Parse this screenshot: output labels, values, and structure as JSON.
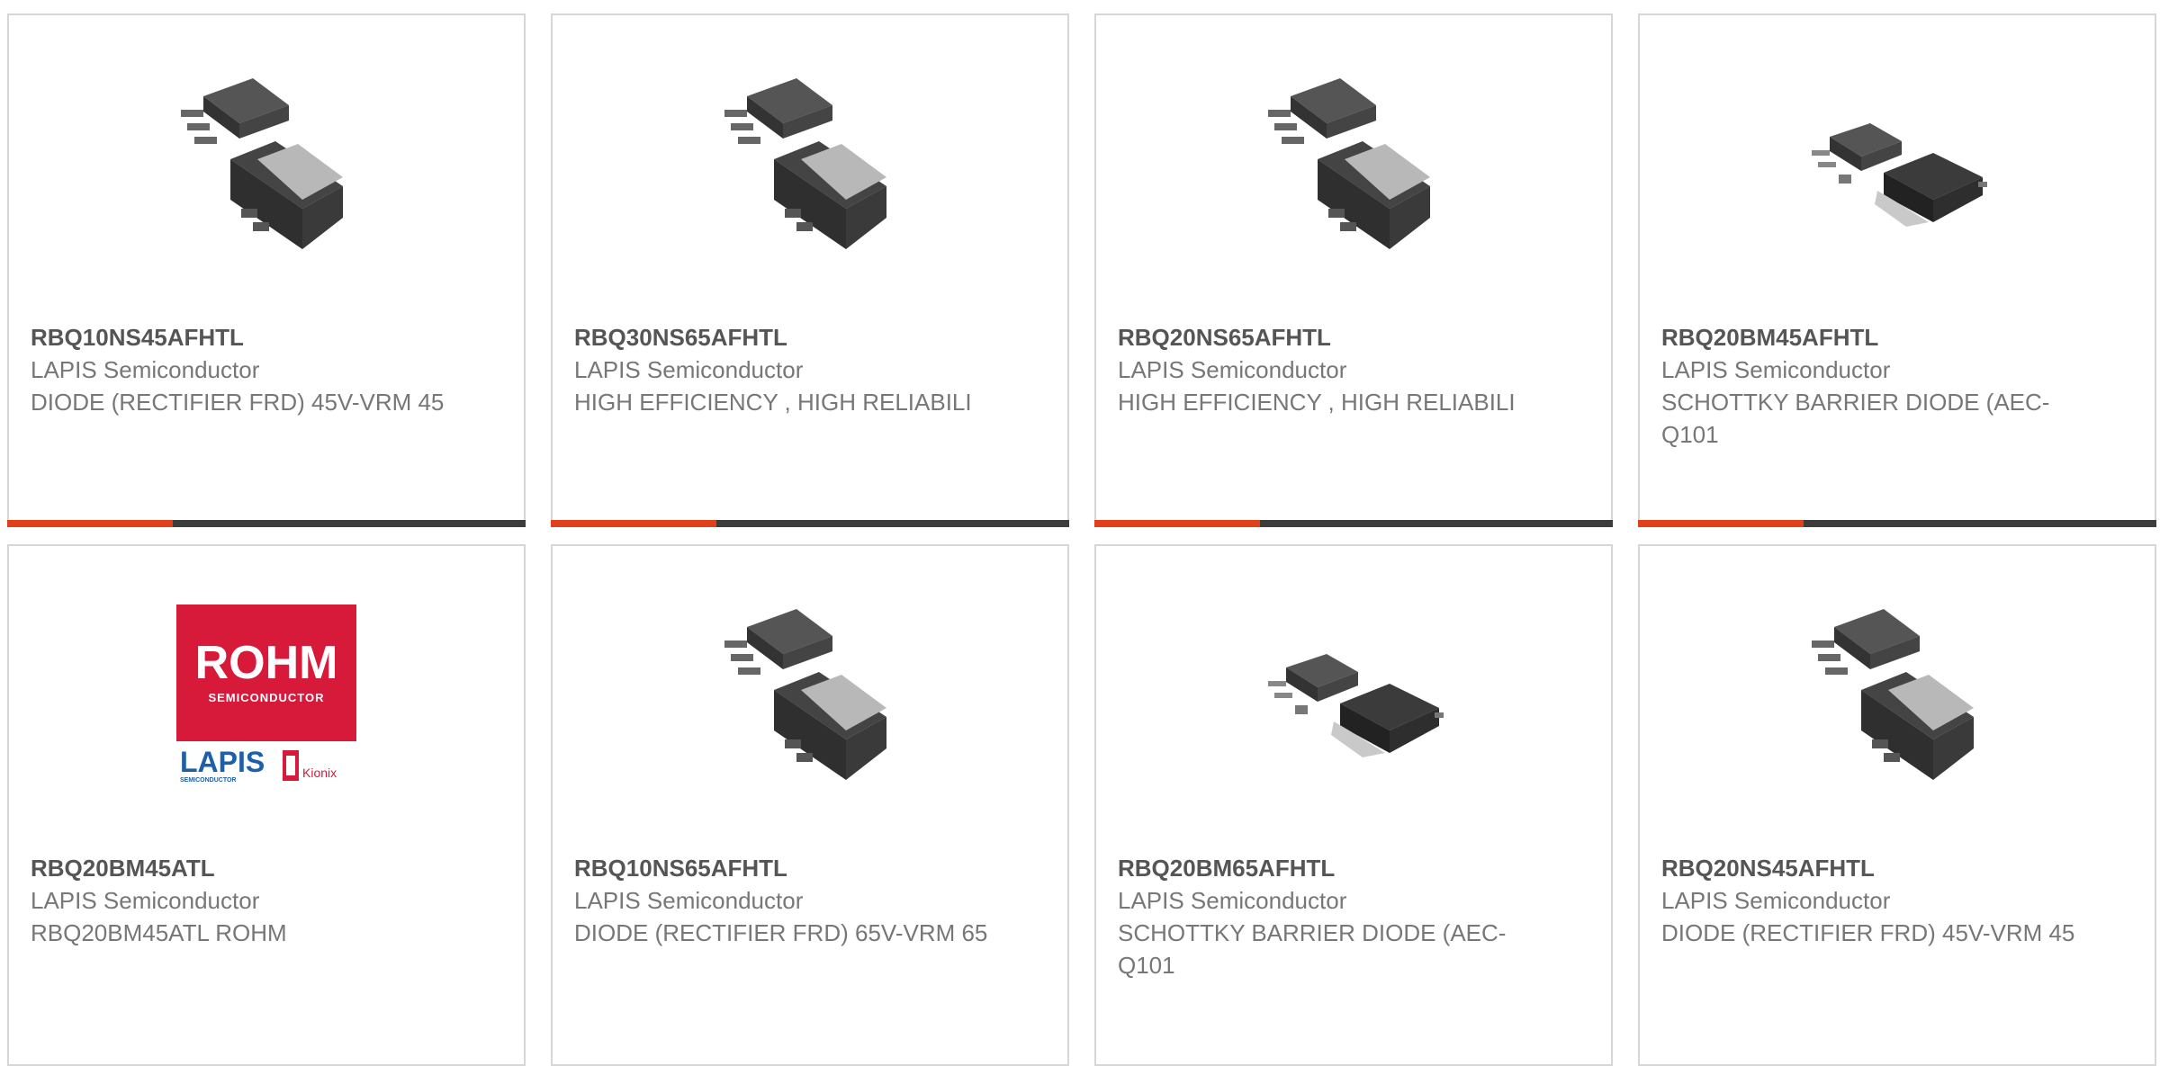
{
  "products": [
    {
      "part": "RBQ10NS45AFHTL",
      "maker": "LAPIS Semiconductor",
      "desc": "DIODE (RECTIFIER FRD) 45V-VRM 45",
      "image": "dpak-package-icon"
    },
    {
      "part": "RBQ30NS65AFHTL",
      "maker": "LAPIS Semiconductor",
      "desc": "HIGH EFFICIENCY , HIGH RELIABILI",
      "image": "dpak-package-icon"
    },
    {
      "part": "RBQ20NS65AFHTL",
      "maker": "LAPIS Semiconductor",
      "desc": "HIGH EFFICIENCY , HIGH RELIABILI",
      "image": "dpak-package-icon"
    },
    {
      "part": "RBQ20BM45AFHTL",
      "maker": "LAPIS Semiconductor",
      "desc": "SCHOTTKY BARRIER DIODE (AEC-Q101",
      "image": "to252-package-icon"
    },
    {
      "part": "RBQ20BM45ATL",
      "maker": "LAPIS Semiconductor",
      "desc": "RBQ20BM45ATL ROHM",
      "image": "rohm-logo",
      "logo": {
        "brand": "ROHM",
        "sub": "SEMICONDUCTOR",
        "lapis": "LAPIS",
        "lapis_sub": "SEMICONDUCTOR",
        "kionix": "Kionix"
      }
    },
    {
      "part": "RBQ10NS65AFHTL",
      "maker": "LAPIS Semiconductor",
      "desc": "DIODE (RECTIFIER FRD) 65V-VRM 65",
      "image": "dpak-package-icon"
    },
    {
      "part": "RBQ20BM65AFHTL",
      "maker": "LAPIS Semiconductor",
      "desc": "SCHOTTKY BARRIER DIODE (AEC-Q101",
      "image": "to252-package-icon"
    },
    {
      "part": "RBQ20NS45AFHTL",
      "maker": "LAPIS Semiconductor",
      "desc": "DIODE (RECTIFIER FRD) 45V-VRM 45",
      "image": "dpak-package-icon"
    }
  ],
  "colors": {
    "accent": "#e0401a",
    "bar": "#3c3c3c",
    "border": "#d6d6d6",
    "logo_red": "#d7193a",
    "lapis_blue": "#1d5fa8"
  }
}
